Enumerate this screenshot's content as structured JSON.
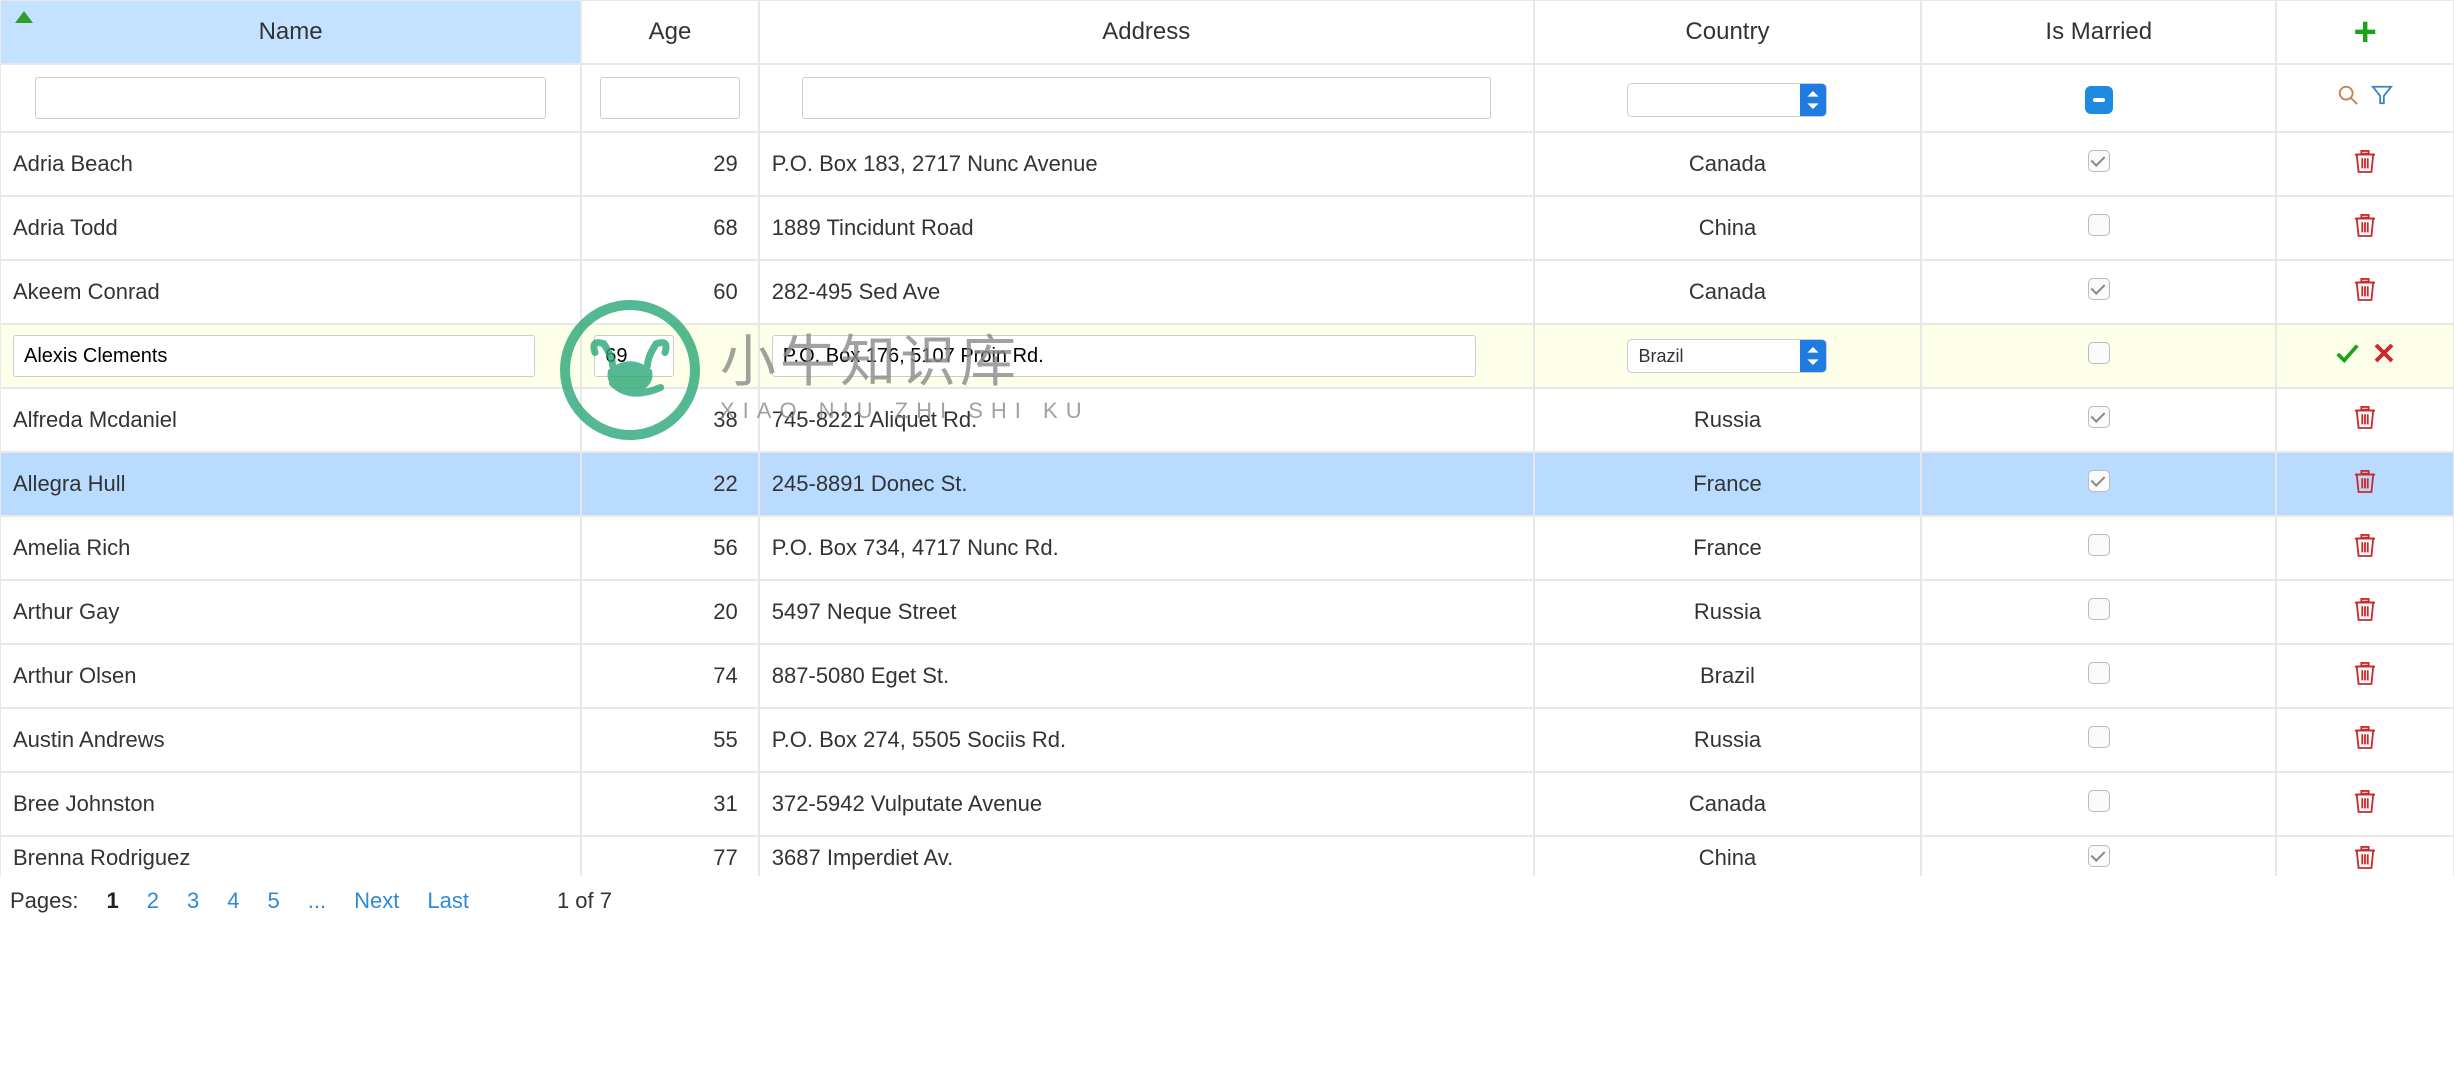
{
  "columns": {
    "name": "Name",
    "age": "Age",
    "address": "Address",
    "country": "Country",
    "married": "Is Married"
  },
  "filter": {
    "name": "",
    "age": "",
    "address": "",
    "country_selected": "",
    "married_state": "indeterminate"
  },
  "edit_row": {
    "name": "Alexis Clements",
    "age": "69",
    "address": "P.O. Box 176, 5107 Proin Rd.",
    "country": "Brazil",
    "married": false
  },
  "rows": [
    {
      "name": "Adria Beach",
      "age": 29,
      "address": "P.O. Box 183, 2717 Nunc Avenue",
      "country": "Canada",
      "married": true
    },
    {
      "name": "Adria Todd",
      "age": 68,
      "address": "1889 Tincidunt Road",
      "country": "China",
      "married": false
    },
    {
      "name": "Akeem Conrad",
      "age": 60,
      "address": "282-495 Sed Ave",
      "country": "Canada",
      "married": true
    },
    {
      "name": "Alfreda Mcdaniel",
      "age": 38,
      "address": "745-8221 Aliquet Rd.",
      "country": "Russia",
      "married": true
    },
    {
      "name": "Allegra Hull",
      "age": 22,
      "address": "245-8891 Donec St.",
      "country": "France",
      "married": true,
      "selected": true
    },
    {
      "name": "Amelia Rich",
      "age": 56,
      "address": "P.O. Box 734, 4717 Nunc Rd.",
      "country": "France",
      "married": false
    },
    {
      "name": "Arthur Gay",
      "age": 20,
      "address": "5497 Neque Street",
      "country": "Russia",
      "married": false
    },
    {
      "name": "Arthur Olsen",
      "age": 74,
      "address": "887-5080 Eget St.",
      "country": "Brazil",
      "married": false
    },
    {
      "name": "Austin Andrews",
      "age": 55,
      "address": "P.O. Box 274, 5505 Sociis Rd.",
      "country": "Russia",
      "married": false
    },
    {
      "name": "Bree Johnston",
      "age": 31,
      "address": "372-5942 Vulputate Avenue",
      "country": "Canada",
      "married": false
    },
    {
      "name": "Brenna Rodriguez",
      "age": 77,
      "address": "3687 Imperdiet Av.",
      "country": "China",
      "married": true,
      "partial": true
    }
  ],
  "pager": {
    "label": "Pages:",
    "pages": [
      "1",
      "2",
      "3",
      "4",
      "5",
      "..."
    ],
    "current": "1",
    "next": "Next",
    "last": "Last",
    "status": "1 of 7"
  },
  "watermark": {
    "cn": "小牛知识库",
    "en": "XIAO NIU ZHI SHI KU"
  }
}
